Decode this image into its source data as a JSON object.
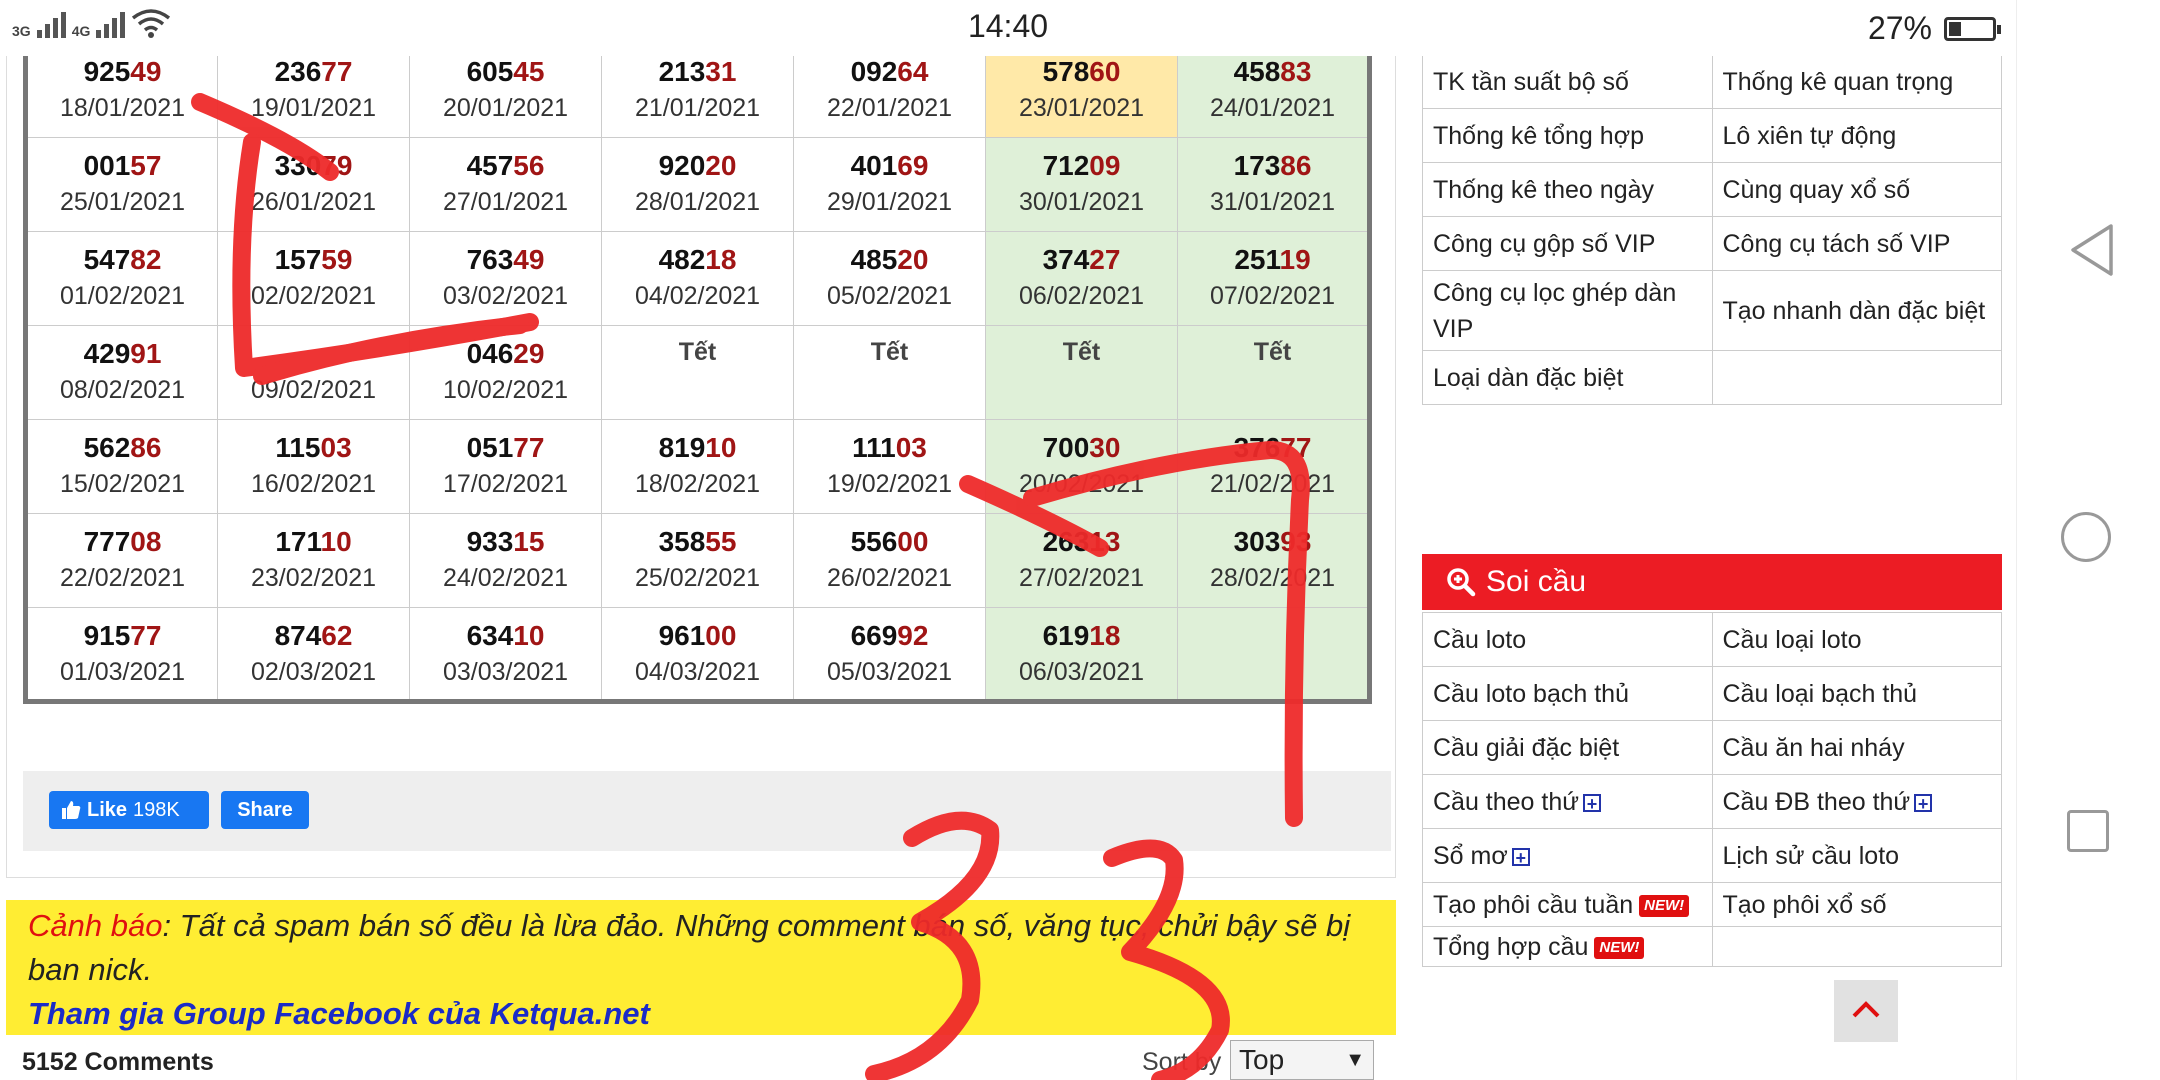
{
  "status_bar": {
    "net1": "3G",
    "net2": "4G",
    "time": "14:40",
    "battery_text": "27%",
    "battery_level": 0.27
  },
  "results": {
    "rows": [
      [
        {
          "head": "925",
          "tail": "49",
          "date": "18/01/2021"
        },
        {
          "head": "236",
          "tail": "77",
          "date": "19/01/2021"
        },
        {
          "head": "605",
          "tail": "45",
          "date": "20/01/2021"
        },
        {
          "head": "213",
          "tail": "31",
          "date": "21/01/2021"
        },
        {
          "head": "092",
          "tail": "64",
          "date": "22/01/2021"
        },
        {
          "head": "578",
          "tail": "60",
          "date": "23/01/2021",
          "today": true
        },
        {
          "head": "458",
          "tail": "83",
          "date": "24/01/2021"
        }
      ],
      [
        {
          "head": "001",
          "tail": "57",
          "date": "25/01/2021"
        },
        {
          "head": "330",
          "tail": "79",
          "date": "26/01/2021"
        },
        {
          "head": "457",
          "tail": "56",
          "date": "27/01/2021"
        },
        {
          "head": "920",
          "tail": "20",
          "date": "28/01/2021"
        },
        {
          "head": "401",
          "tail": "69",
          "date": "29/01/2021"
        },
        {
          "head": "712",
          "tail": "09",
          "date": "30/01/2021"
        },
        {
          "head": "173",
          "tail": "86",
          "date": "31/01/2021"
        }
      ],
      [
        {
          "head": "547",
          "tail": "82",
          "date": "01/02/2021"
        },
        {
          "head": "157",
          "tail": "59",
          "date": "02/02/2021"
        },
        {
          "head": "763",
          "tail": "49",
          "date": "03/02/2021"
        },
        {
          "head": "482",
          "tail": "18",
          "date": "04/02/2021"
        },
        {
          "head": "485",
          "tail": "20",
          "date": "05/02/2021"
        },
        {
          "head": "374",
          "tail": "27",
          "date": "06/02/2021"
        },
        {
          "head": "251",
          "tail": "19",
          "date": "07/02/2021"
        }
      ],
      [
        {
          "head": "429",
          "tail": "91",
          "date": "08/02/2021"
        },
        {
          "head": "",
          "tail": "",
          "date": "09/02/2021"
        },
        {
          "head": "046",
          "tail": "29",
          "date": "10/02/2021"
        },
        {
          "tet": "Tết",
          "date": ""
        },
        {
          "tet": "Tết",
          "date": ""
        },
        {
          "tet": "Tết",
          "date": ""
        },
        {
          "tet": "Tết",
          "date": ""
        }
      ],
      [
        {
          "head": "562",
          "tail": "86",
          "date": "15/02/2021"
        },
        {
          "head": "115",
          "tail": "03",
          "date": "16/02/2021"
        },
        {
          "head": "051",
          "tail": "77",
          "date": "17/02/2021"
        },
        {
          "head": "819",
          "tail": "10",
          "date": "18/02/2021"
        },
        {
          "head": "111",
          "tail": "03",
          "date": "19/02/2021"
        },
        {
          "head": "700",
          "tail": "30",
          "date": "20/02/2021"
        },
        {
          "head": "376",
          "tail": "77",
          "date": "21/02/2021"
        }
      ],
      [
        {
          "head": "777",
          "tail": "08",
          "date": "22/02/2021"
        },
        {
          "head": "171",
          "tail": "10",
          "date": "23/02/2021"
        },
        {
          "head": "933",
          "tail": "15",
          "date": "24/02/2021"
        },
        {
          "head": "358",
          "tail": "55",
          "date": "25/02/2021"
        },
        {
          "head": "556",
          "tail": "00",
          "date": "26/02/2021"
        },
        {
          "head": "263",
          "tail": "13",
          "date": "27/02/2021"
        },
        {
          "head": "303",
          "tail": "93",
          "date": "28/02/2021"
        }
      ],
      [
        {
          "head": "915",
          "tail": "77",
          "date": "01/03/2021"
        },
        {
          "head": "874",
          "tail": "62",
          "date": "02/03/2021"
        },
        {
          "head": "634",
          "tail": "10",
          "date": "03/03/2021"
        },
        {
          "head": "961",
          "tail": "00",
          "date": "04/03/2021"
        },
        {
          "head": "669",
          "tail": "92",
          "date": "05/03/2021"
        },
        {
          "head": "619",
          "tail": "18",
          "date": "06/03/2021"
        },
        {
          "head": "",
          "tail": "",
          "date": ""
        }
      ]
    ]
  },
  "facebook": {
    "like_label": "Like",
    "like_count": "198K",
    "share_label": "Share"
  },
  "warning": {
    "prefix": "Cảnh báo",
    "text": ": Tất cả spam bán số đều là lừa đảo. Những comment bán số, văng tục, chửi bậy sẽ bị ban nick.",
    "group_link": "Tham gia Group Facebook của Ketqua.net"
  },
  "comments": {
    "count_label": "5152 Comments",
    "sort_label": "Sort by",
    "sort_value": "Top"
  },
  "tools_menu": [
    [
      "TK tần suất bộ số",
      "Thống kê quan trọng"
    ],
    [
      "Thống kê tổng hợp",
      "Lô xiên tự động"
    ],
    [
      "Thống kê theo ngày",
      "Cùng quay xổ số"
    ],
    [
      "Công cụ gộp số VIP",
      "Công cụ tách số VIP"
    ],
    [
      "Công cụ lọc ghép dàn VIP",
      "Tạo nhanh dàn đặc biệt"
    ],
    [
      "Loại dàn đặc biệt",
      ""
    ]
  ],
  "soi_cau": {
    "title": "Soi cầu",
    "items": [
      [
        {
          "label": "Cầu loto"
        },
        {
          "label": "Cầu loại loto"
        }
      ],
      [
        {
          "label": "Cầu loto bạch thủ"
        },
        {
          "label": "Cầu loại bạch thủ"
        }
      ],
      [
        {
          "label": "Cầu giải đặc biệt"
        },
        {
          "label": "Cầu ăn hai nháy"
        }
      ],
      [
        {
          "label": "Cầu theo thứ",
          "plus": true
        },
        {
          "label": "Cầu ĐB theo thứ",
          "plus": true
        }
      ],
      [
        {
          "label": "Sổ mơ",
          "plus": true
        },
        {
          "label": "Lịch sử cầu loto"
        }
      ],
      [
        {
          "label": "Tạo phôi cầu tuần",
          "new": true
        },
        {
          "label": "Tạo phôi xổ số"
        }
      ],
      [
        {
          "label": "Tổng hợp cầu",
          "new": true
        },
        {
          "label": ""
        }
      ]
    ],
    "new_badge": "NEW!",
    "plus_glyph": "+"
  },
  "colors": {
    "tail_red": "#a01515",
    "weekend_green": "#dff0d8",
    "today_yellow": "#ffe9a8",
    "soi_red": "#ec1c24",
    "facebook_blue": "#1877f2",
    "scribble_red": "#ee2a2a"
  }
}
